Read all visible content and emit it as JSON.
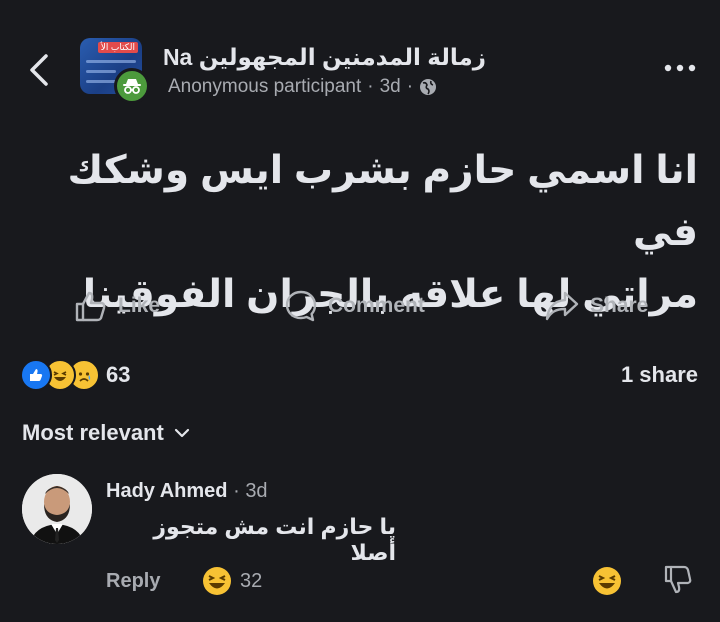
{
  "header": {
    "group_name": "زمالة المدمنين المجهولين Na",
    "author": "Anonymous participant",
    "separator": "·",
    "time": "3d",
    "thumb_tag": "الكتاب الأ"
  },
  "post": {
    "text_line1": "انا اسمي حازم بشرب ايس وشكك في",
    "text_line2": "مراتي لها علاقه بالجران الفوقينا"
  },
  "actions": {
    "like": "Like",
    "comment": "Comment",
    "share": "Share"
  },
  "stats": {
    "reaction_count": "63",
    "shares": "1 share"
  },
  "sort": {
    "label": "Most relevant"
  },
  "comment": {
    "author": "Hady Ahmed",
    "separator": "·",
    "time": "3d",
    "text": "يا حازم انت مش متجوز أصلا",
    "reply_label": "Reply",
    "reaction_count": "32"
  },
  "colors": {
    "background": "#18191d",
    "like_blue": "#1877f2",
    "haha_yellow": "#f7c234",
    "anon_green": "#4c9a3c"
  }
}
